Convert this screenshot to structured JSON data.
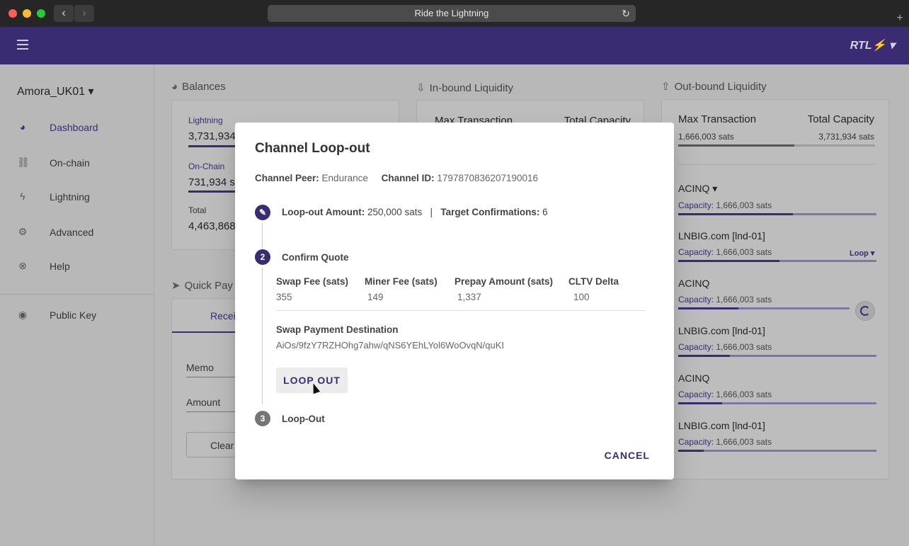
{
  "browser": {
    "url_title": "Ride the Lightning",
    "back_icon": "‹",
    "forward_icon": "›",
    "reload_icon": "↻",
    "newtab_icon": "+"
  },
  "toolbar": {
    "brand": "RTL⚡ ▾",
    "accent": "#3b2b73"
  },
  "sidebar": {
    "node_name": "Amora_UK01 ▾",
    "items": [
      {
        "label": "Dashboard",
        "icon": "dashboard-icon",
        "glyph": "◕"
      },
      {
        "label": "On-chain",
        "icon": "link-icon",
        "glyph": "⛓"
      },
      {
        "label": "Lightning",
        "icon": "lightning-icon",
        "glyph": "ϟ"
      },
      {
        "label": "Advanced",
        "icon": "gear-icon",
        "glyph": "⚙"
      },
      {
        "label": "Help",
        "icon": "help-icon",
        "glyph": "⊗"
      },
      {
        "label": "Public Key",
        "icon": "eye-icon",
        "glyph": "◉"
      }
    ]
  },
  "balances": {
    "title": "Balances",
    "lightning_label": "Lightning",
    "lightning_value": "3,731,934",
    "onchain_label": "On-Chain",
    "onchain_value": "731,934 s",
    "total_label": "Total",
    "total_value": "4,463,868"
  },
  "inbound": {
    "title": "In-bound Liquidity",
    "max_label": "Max Transaction",
    "cap_label": "Total Capacity"
  },
  "outbound": {
    "title": "Out-bound Liquidity",
    "max_label": "Max Transaction",
    "cap_label": "Total Capacity",
    "max_value": "1,666,003 sats",
    "cap_value": "3,731,934 sats",
    "loop_label": "Loop ▾",
    "capacity_label": "Capacity:",
    "channels": [
      {
        "name": "ACINQ ▾",
        "capacity": "1,666,003 sats",
        "fill": 0.58
      },
      {
        "name": "LNBIG.com [lnd-01]",
        "capacity": "1,666,003 sats",
        "fill": 0.51
      },
      {
        "name": "ACINQ",
        "capacity": "1,666,003 sats",
        "fill": 0.35
      },
      {
        "name": "LNBIG.com [lnd-01]",
        "capacity": "1,666,003 sats",
        "fill": 0.26
      },
      {
        "name": "ACINQ",
        "capacity": "1,666,003 sats",
        "fill": 0.22
      },
      {
        "name": "LNBIG.com [lnd-01]",
        "capacity": "1,666,003 sats",
        "fill": 0.13
      }
    ]
  },
  "quick_pay": {
    "title": "Quick Pay",
    "tab_receive": "Recei",
    "memo_label": "Memo",
    "amount_label": "Amount",
    "clear_label": "Clear"
  },
  "dialog": {
    "title": "Channel Loop-out",
    "peer_label": "Channel Peer:",
    "peer_value": "Endurance",
    "channel_id_label": "Channel ID:",
    "channel_id_value": "1797870836207190016",
    "step1_amount_label": "Loop-out Amount:",
    "step1_amount_value": "250,000 sats",
    "step1_sep": "|",
    "step1_conf_label": "Target Confirmations:",
    "step1_conf_value": "6",
    "step2_number": "2",
    "step2_label": "Confirm Quote",
    "quote_headers": [
      "Swap Fee (sats)",
      "Miner Fee (sats)",
      "Prepay Amount (sats)",
      "CLTV Delta"
    ],
    "quote_values": [
      "355",
      "149",
      "1,337",
      "100"
    ],
    "dest_label": "Swap Payment Destination",
    "dest_value": "AiOs/9fzY7RZHOhg7ahw/qNS6YEhLYol6WoOvqN/quKI",
    "loop_out_button": "LOOP OUT",
    "step3_number": "3",
    "step3_label": "Loop-Out",
    "cancel_button": "CANCEL"
  }
}
